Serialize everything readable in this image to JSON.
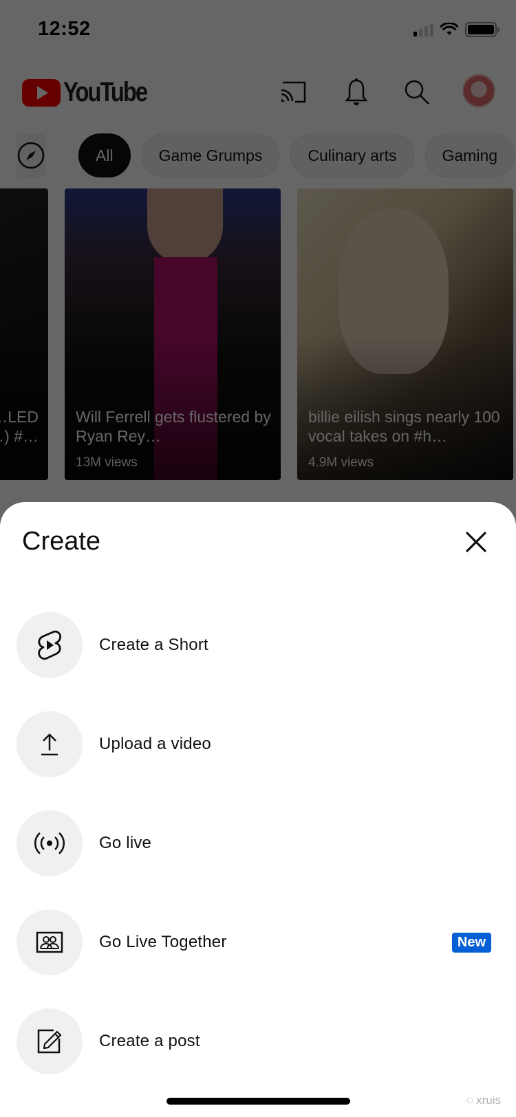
{
  "status_bar": {
    "time": "12:52",
    "signal_bars_active": 1,
    "signal_bars_total": 4,
    "battery_level": 0.95
  },
  "header": {
    "app_name": "YouTube",
    "icons": [
      "cast-icon",
      "bell-icon",
      "search-icon",
      "avatar"
    ]
  },
  "chips": {
    "explore_icon": "compass-icon",
    "items": [
      {
        "label": "All",
        "active": true
      },
      {
        "label": "Game Grumps",
        "active": false
      },
      {
        "label": "Culinary arts",
        "active": false
      },
      {
        "label": "Gaming",
        "active": false
      }
    ]
  },
  "shorts": [
    {
      "title": "…LED\n…) #…",
      "views": ""
    },
    {
      "title": "Will Ferrell gets flustered by Ryan Rey…",
      "views": "13M views"
    },
    {
      "title": "billie eilish sings nearly 100 vocal takes on #h…",
      "views": "4.9M views"
    }
  ],
  "sheet": {
    "title": "Create",
    "close_label": "Close",
    "items": [
      {
        "label": "Create a Short",
        "icon": "shorts-icon",
        "badge": null
      },
      {
        "label": "Upload a video",
        "icon": "upload-icon",
        "badge": null
      },
      {
        "label": "Go live",
        "icon": "live-broadcast-icon",
        "badge": null
      },
      {
        "label": "Go Live Together",
        "icon": "live-together-icon",
        "badge": "New"
      },
      {
        "label": "Create a post",
        "icon": "edit-post-icon",
        "badge": null
      }
    ]
  },
  "colors": {
    "brand_red": "#ff0000",
    "badge_blue": "#065fd4",
    "icon_bg": "#f0f0f0"
  },
  "watermark": "xruis"
}
